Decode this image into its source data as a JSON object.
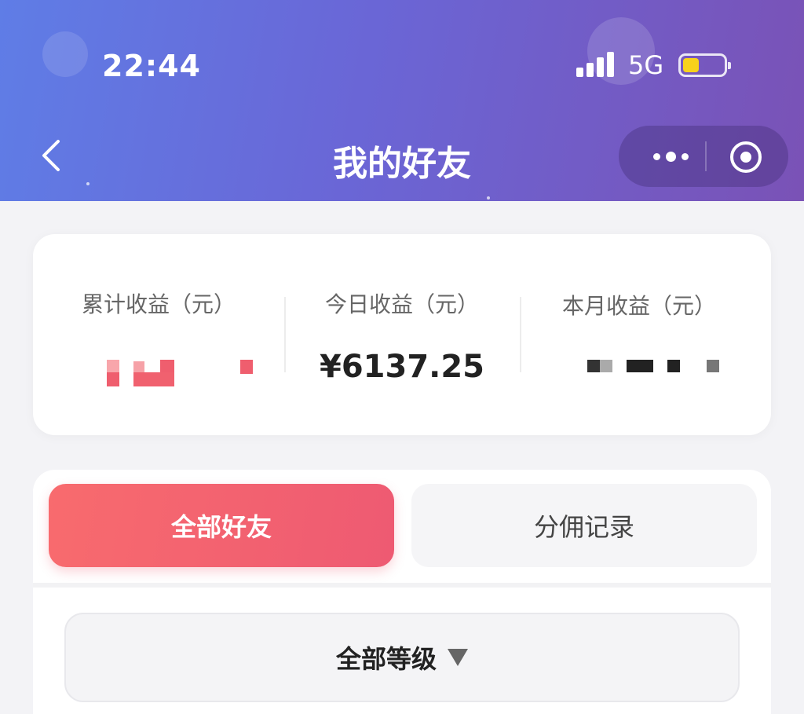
{
  "status_bar": {
    "time": "22:44",
    "network": "5G",
    "battery_level": 0.3,
    "battery_color": "#f7d21c"
  },
  "nav": {
    "title": "我的好友",
    "back_icon": "chevron-left-icon",
    "more_icon": "more-dots-icon",
    "close_icon": "target-circle-icon"
  },
  "earnings": {
    "total_label": "累计收益（元）",
    "today_label": "今日收益（元）",
    "today_value": "¥6137.25",
    "month_label": "本月收益（元）"
  },
  "tabs": {
    "all_friends": "全部好友",
    "commission_records": "分佣记录"
  },
  "filter": {
    "level_select": "全部等级"
  },
  "colors": {
    "header_start": "#5f7de6",
    "header_end": "#7a52b6",
    "accent": "#f2616f"
  }
}
